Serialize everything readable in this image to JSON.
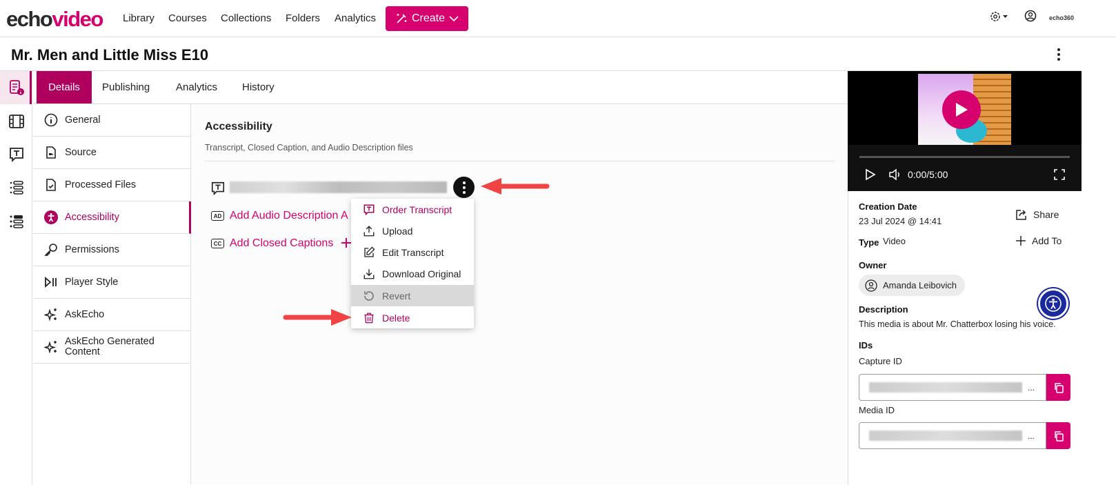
{
  "header": {
    "logo_echo": "echo",
    "logo_video": "video",
    "nav": [
      "Library",
      "Courses",
      "Collections",
      "Folders",
      "Analytics"
    ],
    "create_label": "Create",
    "brand_small": "echo360",
    "icons": [
      "gear-icon",
      "user-icon"
    ]
  },
  "page": {
    "title": "Mr. Men and Little Miss E10"
  },
  "tabs": [
    {
      "label": "Details",
      "active": true
    },
    {
      "label": "Publishing"
    },
    {
      "label": "Analytics"
    },
    {
      "label": "History"
    }
  ],
  "subnav": [
    {
      "label": "General",
      "icon": "info-icon"
    },
    {
      "label": "Source",
      "icon": "file-video-icon"
    },
    {
      "label": "Processed Files",
      "icon": "file-check-icon"
    },
    {
      "label": "Accessibility",
      "icon": "accessibility-icon",
      "active": true
    },
    {
      "label": "Permissions",
      "icon": "key-icon"
    },
    {
      "label": "Player Style",
      "icon": "play-pause-icon"
    },
    {
      "label": "AskEcho",
      "icon": "sparkle-icon"
    },
    {
      "label": "AskEcho Generated Content",
      "icon": "sparkle-icon"
    }
  ],
  "accessibility": {
    "heading": "Accessibility",
    "subtitle": "Transcript, Closed Caption, and Audio Description files",
    "add_audio": "Add Audio Description A",
    "add_captions": "Add Closed Captions",
    "badge_ad": "AD",
    "badge_cc": "CC",
    "badge_t": "T"
  },
  "menu": [
    {
      "label": "Order Transcript",
      "icon": "transcript-icon"
    },
    {
      "label": "Upload",
      "icon": "upload-icon"
    },
    {
      "label": "Edit Transcript",
      "icon": "edit-icon"
    },
    {
      "label": "Download Original",
      "icon": "download-icon"
    },
    {
      "label": "Revert",
      "icon": "revert-icon",
      "disabled": true
    },
    {
      "label": "Delete",
      "icon": "trash-icon"
    }
  ],
  "player": {
    "time": "0:00/5:00"
  },
  "details": {
    "creation_label": "Creation Date",
    "creation_value": "23 Jul 2024 @ 14:41",
    "type_label": "Type",
    "type_value": "Video",
    "owner_label": "Owner",
    "owner_value": "Amanda Leibovich",
    "description_label": "Description",
    "description_value": "This media is about Mr. Chatterbox losing his voice.",
    "ids_label": "IDs",
    "capture_label": "Capture ID",
    "media_id_label": "Media ID",
    "ellipsis": "...",
    "share": "Share",
    "add_to": "Add To"
  },
  "colors": {
    "brand": "#d6006e",
    "active": "#b0005e",
    "arrow": "#f04343",
    "a11y_button": "#1a2a9c"
  }
}
